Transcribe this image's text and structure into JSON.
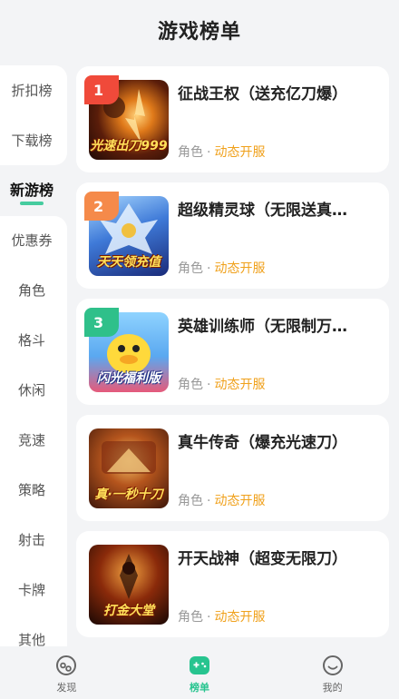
{
  "header": {
    "title": "游戏榜单"
  },
  "sidebar": {
    "items": [
      {
        "label": "折扣榜"
      },
      {
        "label": "下载榜"
      },
      {
        "label": "新游榜"
      },
      {
        "label": "优惠券"
      },
      {
        "label": "角色"
      },
      {
        "label": "格斗"
      },
      {
        "label": "休闲"
      },
      {
        "label": "竞速"
      },
      {
        "label": "策略"
      },
      {
        "label": "射击"
      },
      {
        "label": "卡牌"
      },
      {
        "label": "其他"
      }
    ],
    "active": "新游榜"
  },
  "games": [
    {
      "rank": "1",
      "name": "征战王权（送充亿刀爆）",
      "category": "角色",
      "separator": "·",
      "status": "动态开服",
      "thumb_caption": "光速出刀999",
      "rank_color": "#f04a3a"
    },
    {
      "rank": "2",
      "name": "超级精灵球（无限送真…",
      "category": "角色",
      "separator": "·",
      "status": "动态开服",
      "thumb_caption": "天天领充值",
      "rank_color": "#f58a4a"
    },
    {
      "rank": "3",
      "name": "英雄训练师（无限制万…",
      "category": "角色",
      "separator": "·",
      "status": "动态开服",
      "thumb_caption": "闪光福利版",
      "rank_color": "#2fc08a"
    },
    {
      "rank": "",
      "name": "真牛传奇（爆充光速刀）",
      "category": "角色",
      "separator": "·",
      "status": "动态开服",
      "thumb_caption": "真·一秒十刀",
      "rank_color": ""
    },
    {
      "rank": "",
      "name": "开天战神（超变无限刀）",
      "category": "角色",
      "separator": "·",
      "status": "动态开服",
      "thumb_caption": "打金大堂",
      "rank_color": ""
    }
  ],
  "bottom_nav": {
    "items": [
      {
        "label": "发现",
        "icon": "discover-icon"
      },
      {
        "label": "榜单",
        "icon": "gamepad-icon"
      },
      {
        "label": "我的",
        "icon": "smile-icon"
      }
    ],
    "active": "榜单",
    "accent": "#27c48f"
  }
}
